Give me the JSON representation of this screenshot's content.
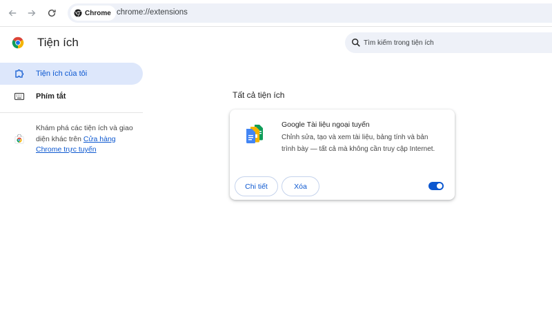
{
  "browser": {
    "chip_label": "Chrome",
    "url": "chrome://extensions"
  },
  "header": {
    "title": "Tiện ích",
    "search_placeholder": "Tìm kiếm trong tiện ích"
  },
  "sidebar": {
    "items": [
      {
        "label": "Tiện ích của tôi",
        "icon": "extension-puzzle-icon",
        "active": true
      },
      {
        "label": "Phím tắt",
        "icon": "keyboard-icon",
        "active": false
      }
    ],
    "store_text": "Khám phá các tiện ích và giao diện khác trên ",
    "store_link": "Cửa hàng Chrome trực tuyến"
  },
  "main": {
    "section_title": "Tất cả tiện ích",
    "extension": {
      "name": "Google Tài liệu ngoại tuyến",
      "description": "Chỉnh sửa, tạo và xem tài liệu, bảng tính và bản trình bày — tất cả mà không cần truy cập Internet.",
      "details_label": "Chi tiết",
      "remove_label": "Xóa",
      "enabled": true
    }
  },
  "colors": {
    "accent": "#0b57d0",
    "active_bg": "#dde7fb",
    "omnibox_bg": "#eef1f8"
  }
}
